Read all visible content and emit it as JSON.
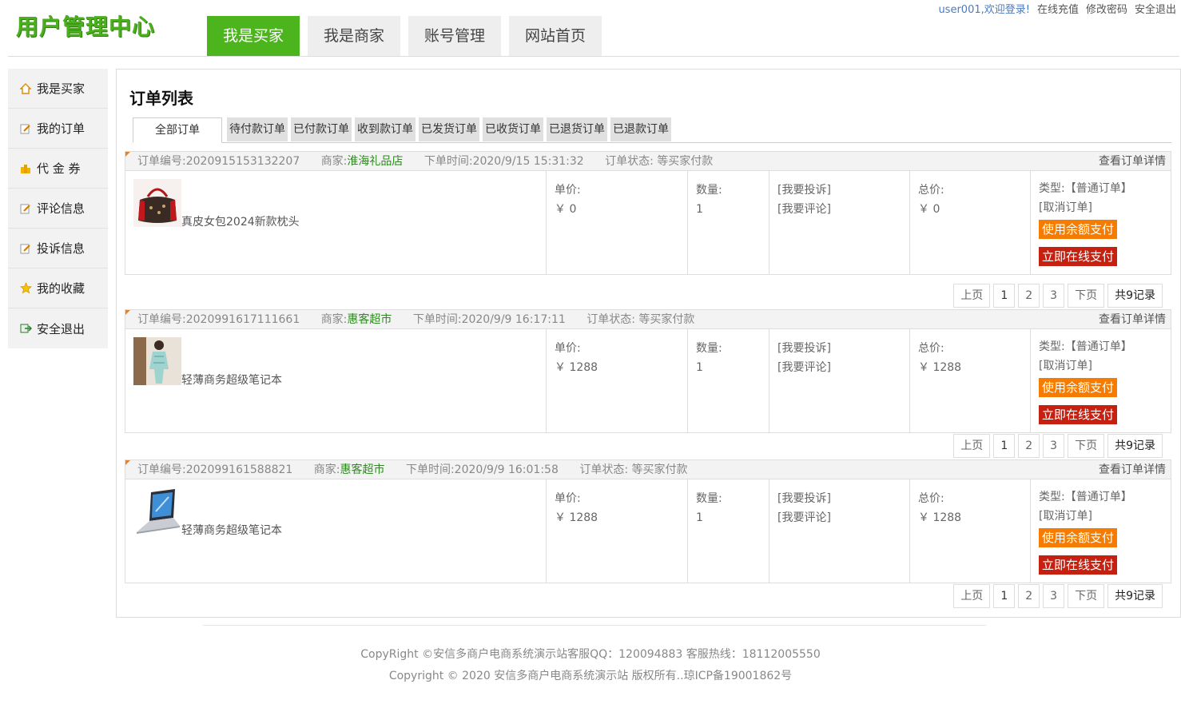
{
  "header": {
    "logo": "用户管理中心",
    "tabs": [
      {
        "label": "我是买家",
        "active": true
      },
      {
        "label": "我是商家",
        "active": false
      },
      {
        "label": "账号管理",
        "active": false
      },
      {
        "label": "网站首页",
        "active": false
      }
    ],
    "welcome": "user001,欢迎登录!",
    "links": [
      "在线充值",
      "修改密码",
      "安全退出"
    ]
  },
  "sidebar": {
    "items": [
      {
        "label": "我是买家",
        "icon": "home-icon"
      },
      {
        "label": "我的订单",
        "icon": "edit-icon"
      },
      {
        "label": "代 金 券",
        "icon": "coins-icon"
      },
      {
        "label": "评论信息",
        "icon": "edit-icon"
      },
      {
        "label": "投诉信息",
        "icon": "edit-icon"
      },
      {
        "label": "我的收藏",
        "icon": "star-icon"
      },
      {
        "label": "安全退出",
        "icon": "exit-icon"
      }
    ]
  },
  "main": {
    "title": "订单列表",
    "tabs": [
      "全部订单",
      "待付款订单",
      "已付款订单",
      "收到款订单",
      "已发货订单",
      "已收货订单",
      "已退货订单",
      "已退款订单"
    ]
  },
  "orders": [
    {
      "no": "订单编号:2020915153132207",
      "shop_prefix": "商家:",
      "shop": "淮海礼品店",
      "time": "下单时间:2020/9/15 15:31:32",
      "status": "订单状态: 等买家付款",
      "detail": "查看订单详情",
      "product": "真皮女包2024新款枕头",
      "price_label": "单价:",
      "price": "￥ 0",
      "qty_label": "数量:",
      "qty": "1",
      "complain": "[我要投诉]",
      "comment": "[我要评论]",
      "total_label": "总价:",
      "total": "￥ 0",
      "type": "类型:【普通订单】",
      "cancel": "[取消订单]",
      "pay_balance": "使用余额支付",
      "pay_online": "立即在线支付",
      "thumb": "handbag"
    },
    {
      "no": "订单编号:2020991617111661",
      "shop_prefix": "商家:",
      "shop": "惠客超市",
      "time": "下单时间:2020/9/9 16:17:11",
      "status": "订单状态: 等买家付款",
      "detail": "查看订单详情",
      "product": "轻薄商务超级笔记本",
      "price_label": "单价:",
      "price": "￥ 1288",
      "qty_label": "数量:",
      "qty": "1",
      "complain": "[我要投诉]",
      "comment": "[我要评论]",
      "total_label": "总价:",
      "total": "￥ 1288",
      "type": "类型:【普通订单】",
      "cancel": "[取消订单]",
      "pay_balance": "使用余额支付",
      "pay_online": "立即在线支付",
      "thumb": "clothing"
    },
    {
      "no": "订单编号:202099161588821",
      "shop_prefix": "商家:",
      "shop": "惠客超市",
      "time": "下单时间:2020/9/9 16:01:58",
      "status": "订单状态: 等买家付款",
      "detail": "查看订单详情",
      "product": "轻薄商务超级笔记本",
      "price_label": "单价:",
      "price": "￥ 1288",
      "qty_label": "数量:",
      "qty": "1",
      "complain": "[我要投诉]",
      "comment": "[我要评论]",
      "total_label": "总价:",
      "total": "￥ 1288",
      "type": "类型:【普通订单】",
      "cancel": "[取消订单]",
      "pay_balance": "使用余额支付",
      "pay_online": "立即在线支付",
      "thumb": "laptop"
    }
  ],
  "pager": {
    "prev": "上页",
    "pages": [
      "1",
      "2",
      "3"
    ],
    "next": "下页",
    "total": "共9记录"
  },
  "footer": {
    "line1": "CopyRight ©安信多商户电商系统演示站客服QQ：120094883 客服热线：18112005550",
    "line2": "Copyright © 2020 安信多商户电商系统演示站 版权所有..琼ICP备19001862号"
  },
  "colors": {
    "brand_green": "#4cb51d",
    "pay_orange": "#f57c00",
    "pay_red": "#c62010"
  }
}
